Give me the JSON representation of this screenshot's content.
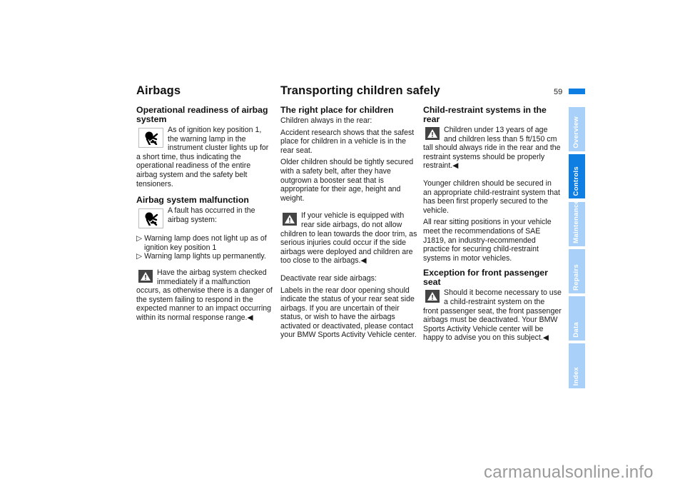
{
  "header": {
    "section_left": "Airbags",
    "section_right": "Transporting children safely",
    "page_number": "59"
  },
  "colors": {
    "accent_blue": "#0f7ee3",
    "tab_light_blue": "#a8d0f8"
  },
  "col1": {
    "h_readiness": "Operational readiness of airbag system",
    "readiness_icon": "airbag-warning-lamp-icon",
    "readiness_text": "As of ignition key position 1, the warning lamp in the instrument cluster lights up for a short time, thus indicating the operational readiness of the entire airbag system and the safety belt tensioners.",
    "h_malfunction": "Airbag system malfunction",
    "malfunction_text": "A fault has occurred in the airbag system:",
    "bullets": [
      "Warning lamp does not light up as of ignition key position 1",
      "Warning lamp lights up permanently."
    ],
    "bullet_glyph": "▷",
    "warning_text": "Have the airbag system checked immediately if a malfunction occurs, as otherwise there is a danger of the system failing to respond in the expected manner to an impact occurring within its normal response range.",
    "end_mark": "◀"
  },
  "col2": {
    "h_right_place": "The right place for children",
    "p1": "Children always in the rear:",
    "p2": "Accident research shows that the safest place for children in a vehicle is in the rear seat.",
    "p3": "Older children should be tightly secured with a safety belt, after they have outgrown a booster seat that is appropriate for their age, height and weight.",
    "warning_text": "If your vehicle is equipped with rear side airbags, do not allow children to lean towards the door trim, as serious injuries could occur if the side airbags were deployed and children are too close to the airbags.",
    "end_mark": "◀",
    "p4": "Deactivate rear side airbags:",
    "p5": "Labels in the rear door opening should indicate the status of your rear seat side airbags. If you are uncertain of their status, or wish to have the airbags activated or deactivated, please contact your BMW Sports Activity Vehicle center."
  },
  "col3": {
    "h_restraint": "Child-restraint systems in the rear",
    "warning_text": "Children under 13 years of age and children less than 5 ft/150 cm tall should always ride in the rear and the restraint systems should be properly restraint.",
    "end_mark": "◀",
    "p1": "Younger children should be secured in an appropriate child-restraint system that has been first properly secured to the vehicle.",
    "p2": "All rear sitting positions in your vehicle meet the recommendations of SAE J1819, an industry-recommended practice for securing child-restraint systems in motor vehicles.",
    "h_exception": "Exception for front passenger seat",
    "warning2_text": "Should it become necessary to use a child-restraint system on the front passenger seat, the front passenger airbags must be deactivated. Your BMW Sports Activity Vehicle center will be happy to advise you on this subject.",
    "end_mark2": "◀"
  },
  "tabs": [
    {
      "label": "Overview",
      "active": false
    },
    {
      "label": "Controls",
      "active": true
    },
    {
      "label": "Maintenance",
      "active": false
    },
    {
      "label": "Repairs",
      "active": false
    },
    {
      "label": "Data",
      "active": false
    },
    {
      "label": "Index",
      "active": false
    }
  ],
  "watermark": "carmanualsonline.info"
}
